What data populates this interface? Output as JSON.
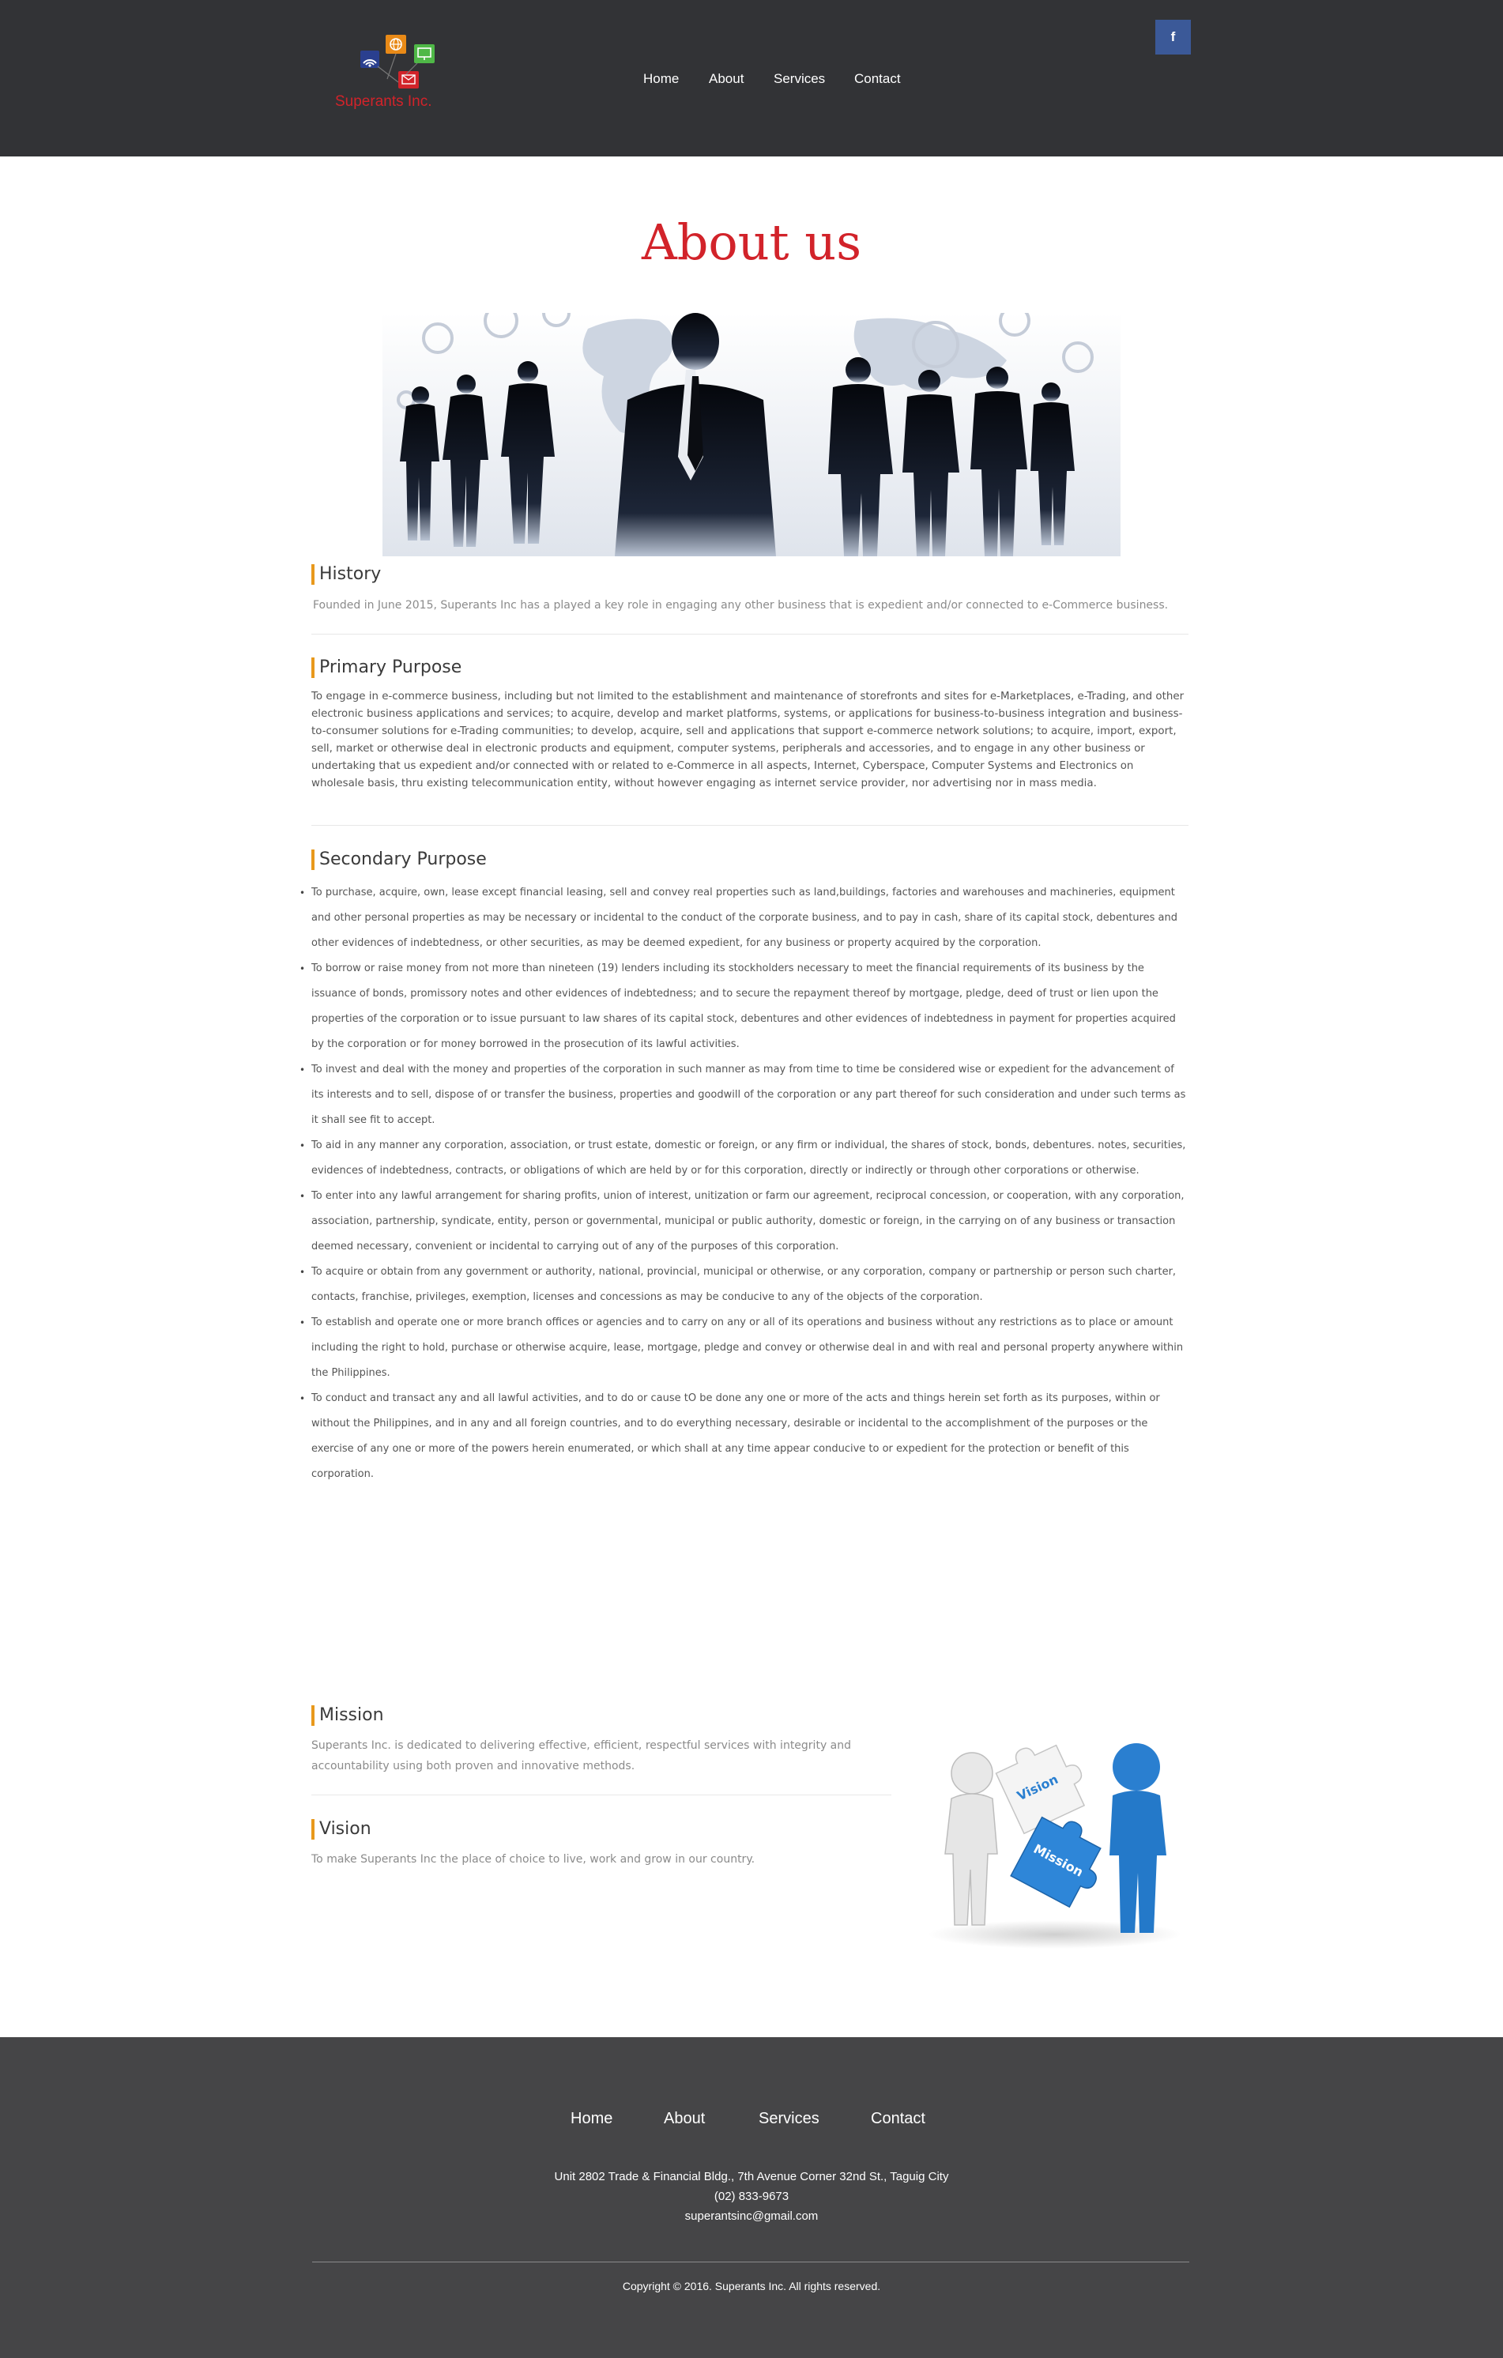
{
  "header": {
    "logo_text": "Superants Inc.",
    "nav": [
      "Home",
      "About",
      "Services",
      "Contact"
    ],
    "facebook_label": "f"
  },
  "page": {
    "title": "About us"
  },
  "history": {
    "title": "History",
    "text": "Founded in June 2015, Superants Inc has a played a key role in engaging any other business that is expedient and/or connected to e-Commerce business."
  },
  "primary": {
    "title": "Primary Purpose",
    "text": "To engage in e-commerce business, including but not limited to the establishment and maintenance of storefronts and sites for e-Marketplaces, e-Trading, and other electronic business applications and services; to acquire, develop and market platforms, systems, or applications for business-to-business integration and business-to-consumer solutions for e-Trading communities; to develop, acquire, sell and applications that support e-commerce network solutions; to acquire, import, export, sell, market or otherwise deal in electronic products and equipment, computer systems, peripherals and accessories, and to engage in any other business or undertaking that us expedient and/or connected with or related to e-Commerce in all aspects, Internet, Cyberspace, Computer Systems and Electronics on wholesale basis, thru existing telecommunication entity, without however engaging as internet service provider, nor advertising nor in mass media."
  },
  "secondary": {
    "title": "Secondary Purpose",
    "items": [
      "To purchase, acquire, own, lease except financial leasing, sell and convey real properties such as land,buildings, factories and warehouses and machineries, equipment and other personal properties as may be necessary or incidental to the conduct of the corporate business, and to pay in cash, share of its capital stock, debentures and other evidences of indebtedness, or other securities, as may be deemed expedient, for any business or property acquired by the corporation.",
      "To borrow or raise money from not more than nineteen (19) lenders including its stockholders necessary to meet the financial requirements of its business by the issuance of bonds, promissory notes and other evidences of indebtedness; and to secure the repayment thereof by mortgage, pledge, deed of trust or lien upon the properties of the corporation or to issue pursuant to law shares of its capital stock, debentures and other evidences of indebtedness in payment for properties acquired by the corporation or for money borrowed in the prosecution of its lawful activities.",
      "To invest and deal with the money and properties of the corporation in such manner as may from time to time be considered wise or expedient for the advancement of its interests and to sell, dispose of or transfer the business, properties and goodwill of the corporation or any part thereof for such consideration and under such terms as it shall see fit to accept.",
      "To aid in any manner any corporation, association, or trust estate, domestic or foreign, or any firm or individual, the shares of stock, bonds, debentures. notes, securities, evidences of indebtedness, contracts, or obligations of which are held by or for this corporation, directly or indirectly or through other corporations or otherwise.",
      "To enter into any lawful arrangement for sharing profits, union of interest, unitization or farm our agreement, reciprocal concession, or cooperation, with any corporation, association, partnership, syndicate, entity, person or governmental, municipal or public authority, domestic or foreign, in the carrying on of any business or transaction deemed necessary, convenient or incidental to carrying out of any of the purposes of this corporation.",
      "To acquire or obtain from any government or authority, national, provincial, municipal or otherwise, or any corporation, company or partnership or person such charter, contacts, franchise, privileges, exemption, licenses and concessions as may be conducive to any of the objects of the corporation.",
      "To establish and operate one or more branch offices or agencies and to carry on any or all of its operations and business without any restrictions as to place or amount including the right to hold, purchase or otherwise acquire, lease, mortgage, pledge and convey or otherwise deal in and with real and personal property anywhere within the Philippines.",
      "To conduct and transact any and all lawful activities, and to do or cause tO be done any one or more of the acts and things herein set forth as its purposes, within or without the Philippines, and in any and all foreign countries, and to do everything necessary, desirable or incidental to the accomplishment of the purposes or the exercise of any one or more of the powers herein enumerated, or which shall at any time appear conducive to or expedient for the protection or benefit of this corporation."
    ]
  },
  "mission": {
    "title": "Mission",
    "text": "Superants Inc. is dedicated to delivering effective, efficient, respectful services with integrity and accountability using both proven and innovative methods."
  },
  "vision": {
    "title": "Vision",
    "text": "To make Superants Inc the place of choice to live, work and grow in our country."
  },
  "puzzle": {
    "vision_label": "Vision",
    "mission_label": "Mission"
  },
  "footer": {
    "nav": [
      "Home",
      "About",
      "Services",
      "Contact"
    ],
    "address": "Unit 2802 Trade & Financial Bldg., 7th Avenue Corner 32nd St., Taguig City",
    "phone": "(02) 833-9673",
    "email": "superantsinc@gmail.com",
    "copyright": "Copyright © 2016. Superants Inc. All rights reserved."
  },
  "colors": {
    "header_bg": "#323336",
    "footer_bg": "#454547",
    "accent_red": "#d2232a",
    "section_marker": "#e8991c",
    "facebook_blue": "#3b5998"
  }
}
